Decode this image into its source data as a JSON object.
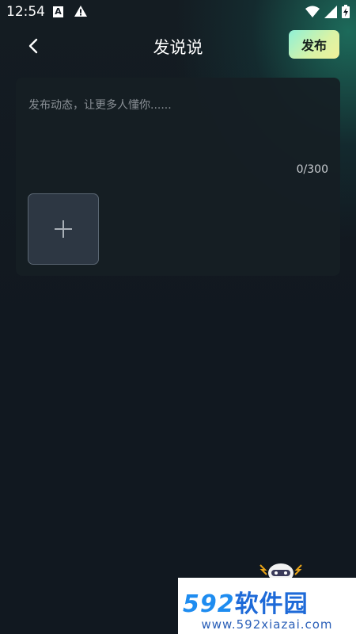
{
  "status_bar": {
    "time": "12:54",
    "a_badge": "A",
    "icons": [
      "a-notification-icon",
      "warning-icon",
      "wifi-icon",
      "signal-icon",
      "battery-icon"
    ]
  },
  "header": {
    "title": "发说说",
    "publish_label": "发布"
  },
  "composer": {
    "placeholder": "发布动态，让更多人懂你......",
    "value": "",
    "char_count": "0/300",
    "add_image_icon": "plus-icon"
  },
  "watermark": {
    "brand_number": "592",
    "brand_text": "软件园",
    "url": "www.592xiazai.com"
  },
  "colors": {
    "background": "#111820",
    "glow": "#1e7864",
    "publish_gradient_start": "#8ff0d6",
    "publish_gradient_end": "#f1f09a",
    "card": "#161e24",
    "add_tile": "#2d3743"
  }
}
